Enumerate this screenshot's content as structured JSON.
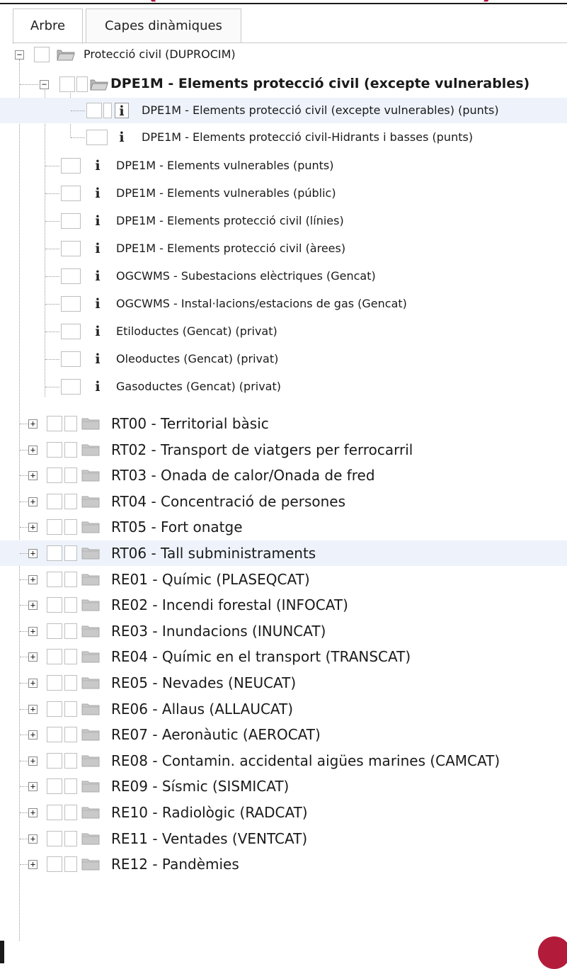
{
  "tabs": [
    {
      "label": "Arbre",
      "active": true
    },
    {
      "label": "Capes dinàmiques",
      "active": false
    }
  ],
  "tree": {
    "root": {
      "label": "Protecció civil (DUPROCIM)",
      "toggle": "−"
    },
    "group": {
      "label": "DPE1M - Elements protecció civil (excepte vulnerables)",
      "toggle": "−"
    },
    "group_children": [
      {
        "label": "DPE1M - Elements protecció civil (excepte vulnerables) (punts)",
        "info": "i"
      },
      {
        "label": "DPE1M - Elements protecció civil-Hidrants i basses (punts)",
        "info": "i"
      }
    ],
    "layers": [
      {
        "label": "DPE1M - Elements vulnerables (punts)",
        "info": "i"
      },
      {
        "label": "DPE1M - Elements vulnerables (públic)",
        "info": "i"
      },
      {
        "label": "DPE1M - Elements protecció civil (línies)",
        "info": "i"
      },
      {
        "label": "DPE1M - Elements protecció civil (àrees)",
        "info": "i"
      },
      {
        "label": "OGCWMS - Subestacions elèctriques (Gencat)",
        "info": "i"
      },
      {
        "label": "OGCWMS - Instal·lacions/estacions de gas (Gencat)",
        "info": "i"
      },
      {
        "label": "Etiloductes (Gencat) (privat)",
        "info": "i"
      },
      {
        "label": "Oleoductes (Gencat) (privat)",
        "info": "i"
      },
      {
        "label": "Gasoductes (Gencat) (privat)",
        "info": "i"
      }
    ],
    "folders": [
      {
        "label": "RT00 - Territorial bàsic",
        "toggle": "+"
      },
      {
        "label": "RT02 - Transport de viatgers per ferrocarril",
        "toggle": "+"
      },
      {
        "label": "RT03 - Onada de calor/Onada de fred",
        "toggle": "+"
      },
      {
        "label": "RT04 - Concentració de persones",
        "toggle": "+"
      },
      {
        "label": "RT05 - Fort onatge",
        "toggle": "+"
      },
      {
        "label": "RT06 - Tall subministraments",
        "toggle": "+"
      },
      {
        "label": "RE01 - Químic (PLASEQCAT)",
        "toggle": "+"
      },
      {
        "label": "RE02 - Incendi forestal (INFOCAT)",
        "toggle": "+"
      },
      {
        "label": "RE03 - Inundacions (INUNCAT)",
        "toggle": "+"
      },
      {
        "label": "RE04 - Químic en el transport (TRANSCAT)",
        "toggle": "+"
      },
      {
        "label": "RE05 - Nevades (NEUCAT)",
        "toggle": "+"
      },
      {
        "label": "RE06 - Allaus (ALLAUCAT)",
        "toggle": "+"
      },
      {
        "label": "RE07 - Aeronàutic (AEROCAT)",
        "toggle": "+"
      },
      {
        "label": "RE08 - Contamin. accidental aigües marines (CAMCAT)",
        "toggle": "+"
      },
      {
        "label": "RE09 - Sísmic (SISMICAT)",
        "toggle": "+"
      },
      {
        "label": "RE10 - Radiològic (RADCAT)",
        "toggle": "+"
      },
      {
        "label": "RE11 - Ventades (VENTCAT)",
        "toggle": "+"
      },
      {
        "label": "RE12 - Pandèmies",
        "toggle": "+"
      }
    ]
  },
  "colors": {
    "accent_title": "#b0113a",
    "highlight_row": "#eef3fb",
    "folder_gray": "#c9c9c9",
    "seal": "#b31b3a"
  },
  "icons": {
    "folder": "folder-icon",
    "open_folder": "folder-open-icon",
    "info": "info-icon",
    "expand": "expand-icon",
    "collapse": "collapse-icon"
  }
}
